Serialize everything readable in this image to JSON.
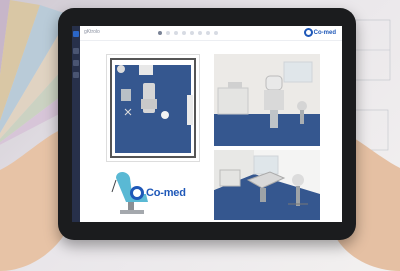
{
  "app": {
    "title": "gKtrolo"
  },
  "sidebar": {
    "items": [
      {
        "icon": "home-icon",
        "active": true
      },
      {
        "icon": "menu-icon",
        "active": false
      },
      {
        "icon": "list-icon",
        "active": false
      },
      {
        "icon": "settings-icon",
        "active": false
      }
    ]
  },
  "pager": {
    "pages": 8,
    "current": 1
  },
  "brand": {
    "logo_text_small": "Co-med",
    "logo_text_large": "Co-med",
    "color": "#1f58b8"
  },
  "colors": {
    "floor_blue": "#35578f",
    "tablet_frame": "#1b1c1e",
    "chair_teal": "#5ab9d4"
  }
}
